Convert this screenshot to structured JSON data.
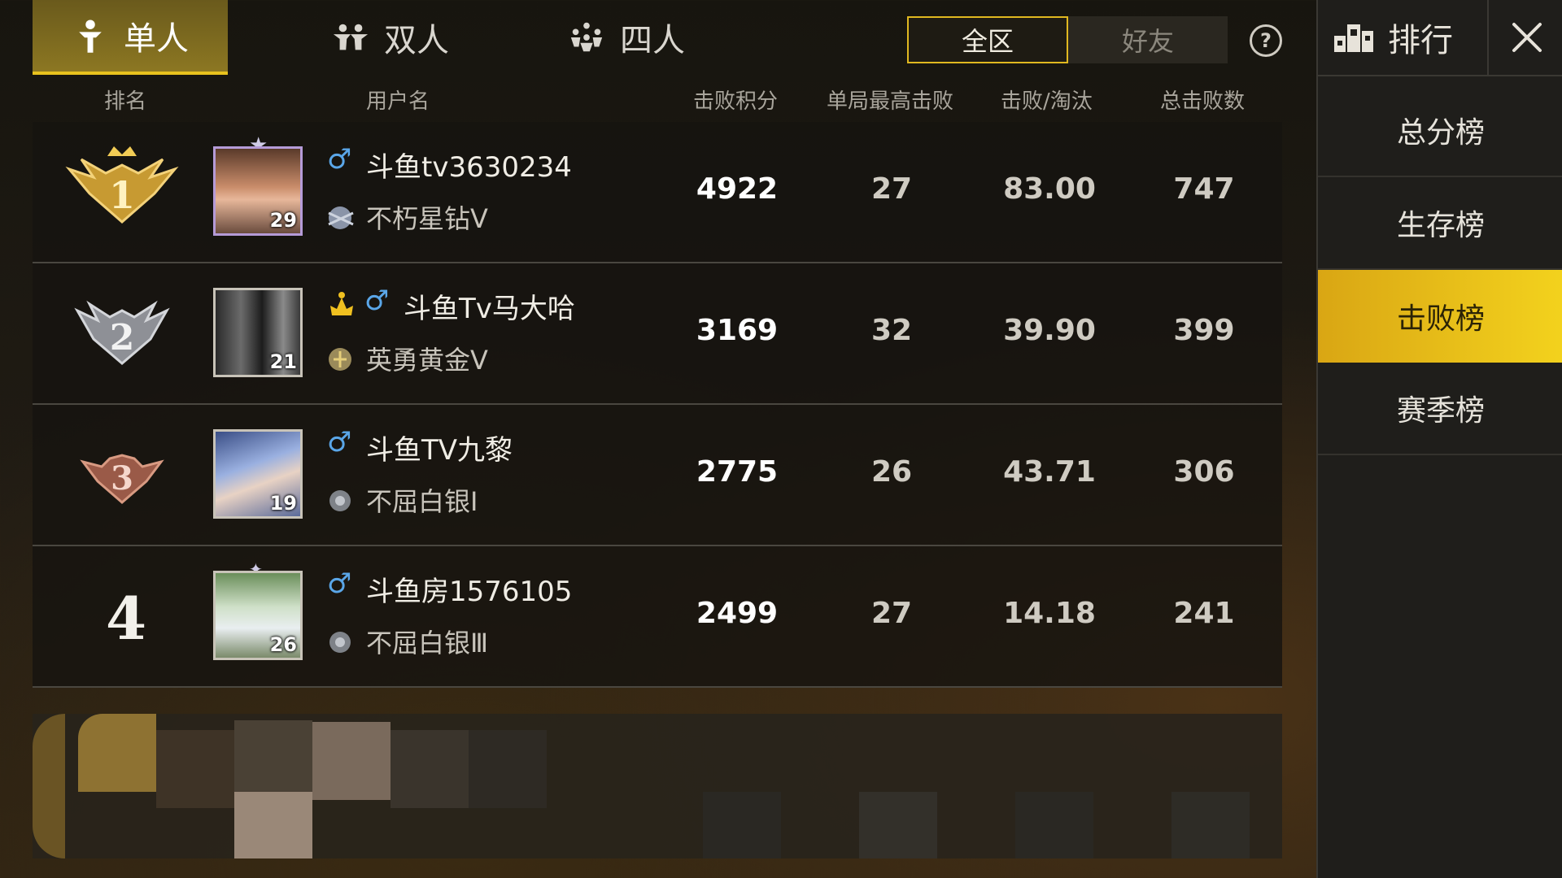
{
  "tabs": {
    "solo": "单人",
    "duo": "双人",
    "squad": "四人"
  },
  "scope": {
    "all": "全区",
    "friends": "好友"
  },
  "help": "?",
  "columns": {
    "rank": "排名",
    "username": "用户名",
    "score": "击败积分",
    "max_kills": "单局最高击败",
    "kd": "击败/淘汰",
    "total_kills": "总击败数"
  },
  "rows": [
    {
      "rank": "1",
      "name": "斗鱼tv3630234",
      "tier": "不朽星钻Ⅴ",
      "level": "29",
      "score": "4922",
      "max_kills": "27",
      "kd": "83.00",
      "total": "747"
    },
    {
      "rank": "2",
      "name": "斗鱼Tv马大哈",
      "tier": "英勇黄金Ⅴ",
      "level": "21",
      "score": "3169",
      "max_kills": "32",
      "kd": "39.90",
      "total": "399"
    },
    {
      "rank": "3",
      "name": "斗鱼TV九黎",
      "tier": "不屈白银Ⅰ",
      "level": "19",
      "score": "2775",
      "max_kills": "26",
      "kd": "43.71",
      "total": "306"
    },
    {
      "rank": "4",
      "name": "斗鱼房1576105",
      "tier": "不屈白银Ⅲ",
      "level": "26",
      "score": "2499",
      "max_kills": "27",
      "kd": "14.18",
      "total": "241"
    }
  ],
  "panel": {
    "title": "排行",
    "boards": [
      "总分榜",
      "生存榜",
      "击败榜",
      "赛季榜"
    ],
    "active_board": "击败榜"
  },
  "colors": {
    "accent": "#e8c21e",
    "male": "#5aa6e8"
  }
}
